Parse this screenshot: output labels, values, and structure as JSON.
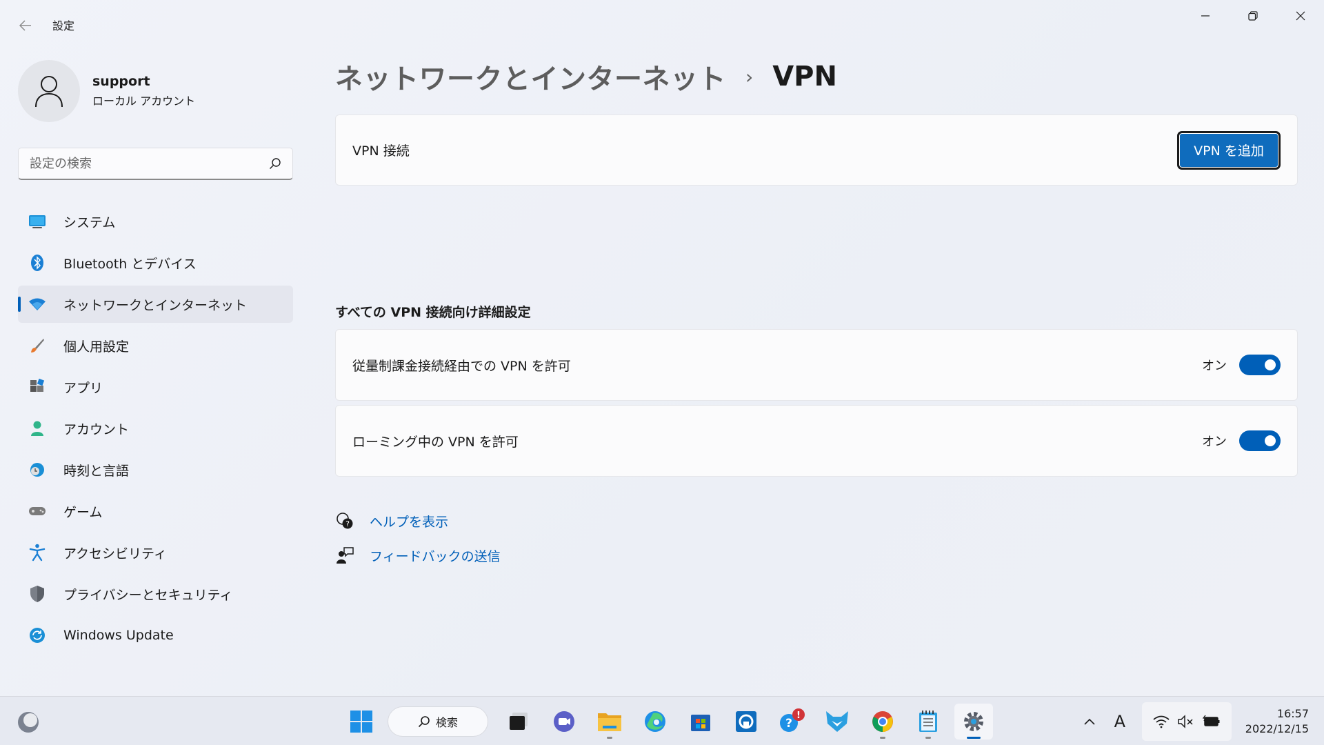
{
  "window": {
    "title": "設定"
  },
  "profile": {
    "name": "support",
    "subtitle": "ローカル アカウント"
  },
  "search": {
    "placeholder": "設定の検索"
  },
  "sidebar": {
    "items": [
      {
        "label": "システム",
        "icon": "system-icon"
      },
      {
        "label": "Bluetooth とデバイス",
        "icon": "bluetooth-icon"
      },
      {
        "label": "ネットワークとインターネット",
        "icon": "wifi-icon",
        "active": true
      },
      {
        "label": "個人用設定",
        "icon": "brush-icon"
      },
      {
        "label": "アプリ",
        "icon": "apps-icon"
      },
      {
        "label": "アカウント",
        "icon": "person-icon"
      },
      {
        "label": "時刻と言語",
        "icon": "globe-clock-icon"
      },
      {
        "label": "ゲーム",
        "icon": "gamepad-icon"
      },
      {
        "label": "アクセシビリティ",
        "icon": "accessibility-icon"
      },
      {
        "label": "プライバシーとセキュリティ",
        "icon": "shield-icon"
      },
      {
        "label": "Windows Update",
        "icon": "update-icon"
      }
    ]
  },
  "breadcrumb": {
    "parent": "ネットワークとインターネット",
    "separator": "›",
    "current": "VPN"
  },
  "vpn_card": {
    "label": "VPN 接続",
    "add_button": "VPN を追加"
  },
  "advanced": {
    "title": "すべての VPN 接続向け詳細設定",
    "settings": [
      {
        "label": "従量制課金接続経由での VPN を許可",
        "state": "オン",
        "on": true
      },
      {
        "label": "ローミング中の VPN を許可",
        "state": "オン",
        "on": true
      }
    ]
  },
  "links": {
    "help": "ヘルプを表示",
    "feedback": "フィードバックの送信"
  },
  "taskbar": {
    "search_label": "検索",
    "apps": [
      "start-icon",
      "search",
      "task-view-icon",
      "chat-icon",
      "file-explorer-icon",
      "edge-icon",
      "store-icon",
      "app-icon",
      "help-icon",
      "app-icon-2",
      "chrome-icon",
      "notepad-icon",
      "settings-icon"
    ],
    "ime": "A",
    "time": "16:57",
    "date": "2022/12/15"
  },
  "colors": {
    "accent": "#005fb8",
    "button": "#0f6cbd",
    "link": "#005fb8"
  }
}
